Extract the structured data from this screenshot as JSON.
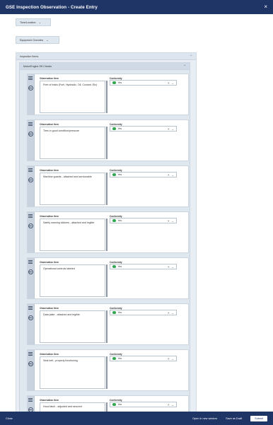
{
  "window": {
    "title": "GSE Inspection Observation - Create Entry",
    "close_glyph": "×"
  },
  "sections": {
    "time_location": "Time/Location",
    "equipment_overview": "Equipment Overview",
    "inspection_items": "Inspection Items",
    "motor_engine_off_checks": "Motor/Engine Off Checks"
  },
  "field_labels": {
    "observation_item": "Observation Item",
    "conformity": "Conformity"
  },
  "items": [
    {
      "observation": "Free of leaks (Fuel, Hydraulic, Oil, Coolant, Etc)",
      "conformity": "Yes"
    },
    {
      "observation": "Tires in good condition/pressure",
      "conformity": "Yes"
    },
    {
      "observation": "Machine guards - attached and serviceable",
      "conformity": "Yes"
    },
    {
      "observation": "Safety warning stickers - attached and legible",
      "conformity": "Yes"
    },
    {
      "observation": "Operational controls labeled",
      "conformity": "Yes"
    },
    {
      "observation": "Data plate - attached and legible",
      "conformity": "Yes"
    },
    {
      "observation": "Seat belt - properly functioning",
      "conformity": "Yes"
    },
    {
      "observation": "Hood latch - adjusted and secured",
      "conformity": "Yes"
    }
  ],
  "icons": {
    "chevron_down": "⌄",
    "chevron_up": "⌃",
    "clear": "×",
    "dropdown": "⌄"
  },
  "colors": {
    "header_bar": "#1f3566",
    "status_yes": "#2fa84f"
  },
  "footer": {
    "close": "Close",
    "open_new_window": "Open in new window",
    "save_draft": "Save as Draft",
    "submit": "Submit"
  }
}
